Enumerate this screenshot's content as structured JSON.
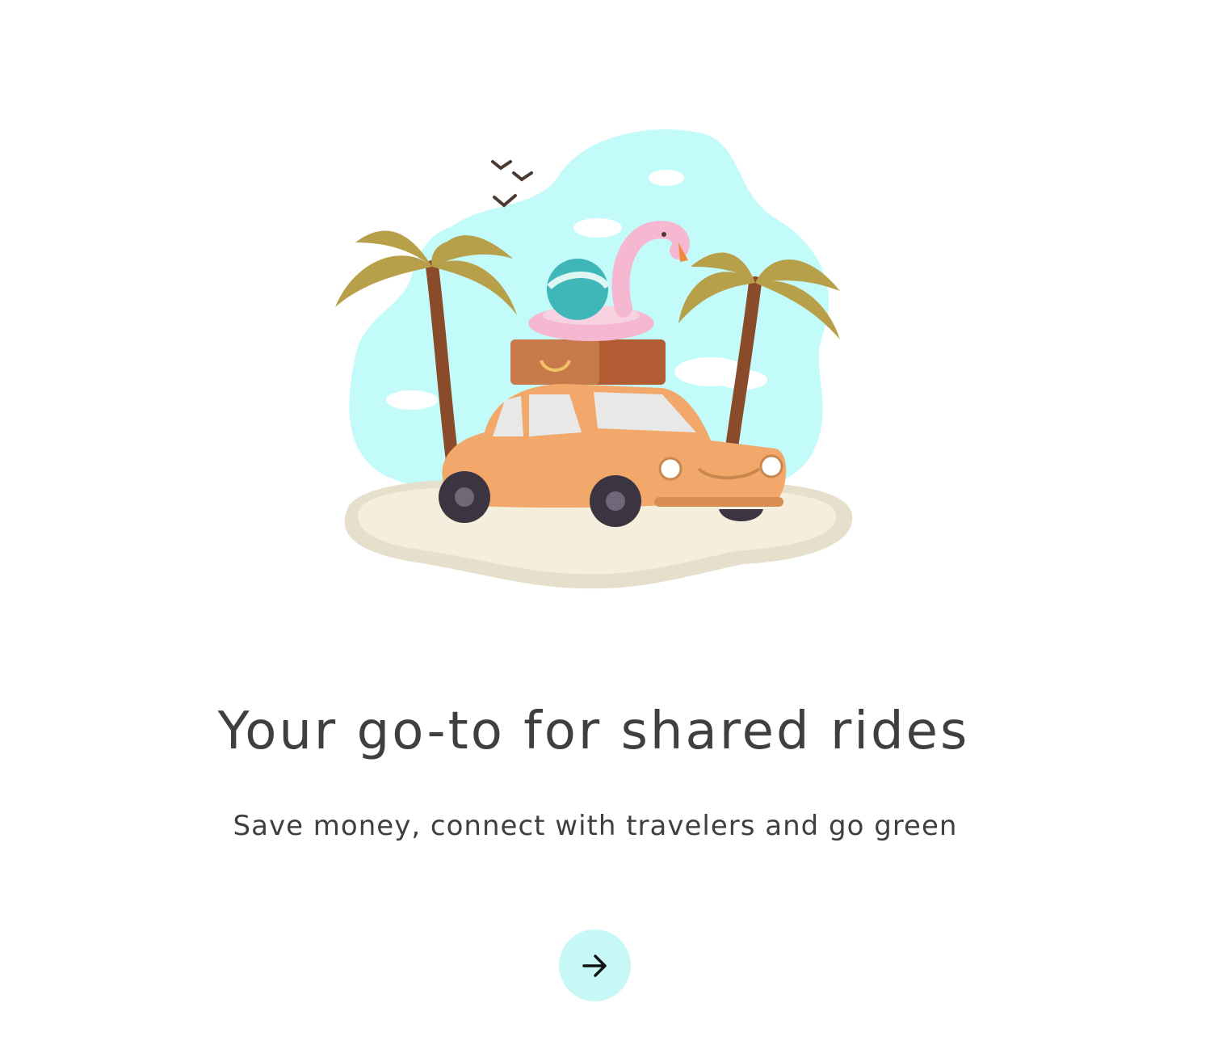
{
  "onboarding": {
    "title": "Your go-to for shared rides",
    "subtitle": "Save money, connect with travelers and go green",
    "next_icon": "arrow-right-icon",
    "illustration": "car-on-beach-illustration"
  },
  "colors": {
    "background": "#ffffff",
    "text": "#3f3f3f",
    "button_bg": "#c8f7f8",
    "sky": "#c3fafa",
    "sand": "#f6eedc",
    "car": "#f2a86a"
  }
}
